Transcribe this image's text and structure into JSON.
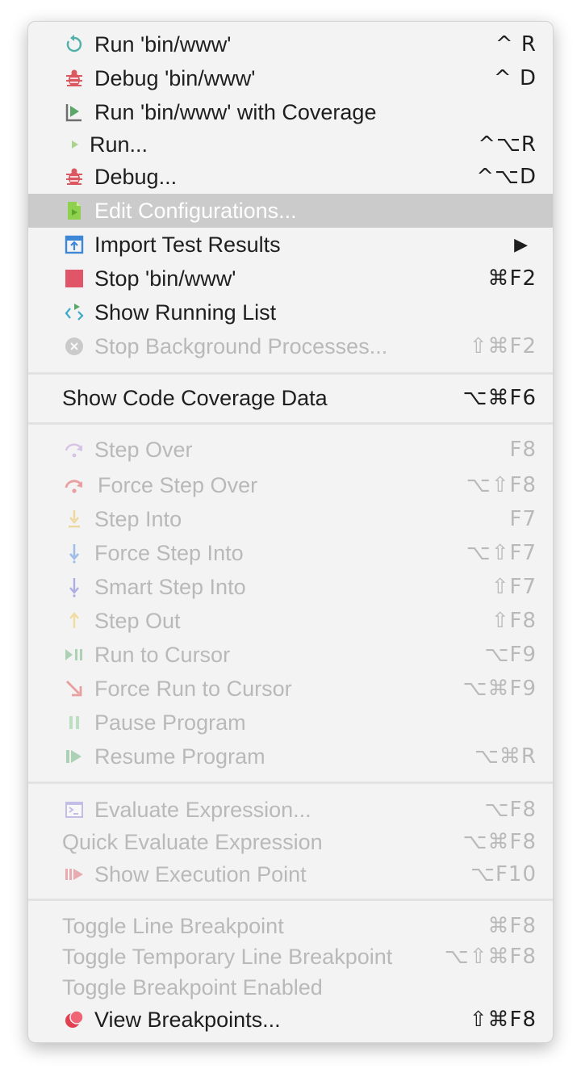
{
  "menu": {
    "items": [
      {
        "id": "run",
        "label": "Run 'bin/www'",
        "shortcut": "^ R",
        "icon": "rerun-icon"
      },
      {
        "id": "debug",
        "label": "Debug 'bin/www'",
        "shortcut": "^ D",
        "icon": "bug-icon"
      },
      {
        "id": "run-coverage",
        "label": "Run 'bin/www' with Coverage",
        "shortcut": "",
        "icon": "coverage-icon"
      },
      {
        "id": "run-dots",
        "label": "Run...",
        "shortcut": "^⌥R",
        "icon": "play-icon"
      },
      {
        "id": "debug-dots",
        "label": "Debug...",
        "shortcut": "^⌥D",
        "icon": "bug-icon"
      },
      {
        "id": "edit-configurations",
        "label": "Edit Configurations...",
        "shortcut": "",
        "icon": "edit-config-icon",
        "selected": true
      },
      {
        "id": "import-test-results",
        "label": "Import Test Results",
        "shortcut": "▶",
        "icon": "import-icon",
        "submenu": true
      },
      {
        "id": "stop",
        "label": "Stop 'bin/www'",
        "shortcut": "⌘F2",
        "icon": "stop-icon"
      },
      {
        "id": "show-running-list",
        "label": "Show Running List",
        "shortcut": "",
        "icon": "running-list-icon"
      },
      {
        "id": "stop-background",
        "label": "Stop Background Processes...",
        "shortcut": "⇧⌘F2",
        "icon": "cancel-icon",
        "disabled": true
      },
      {
        "id": "show-code-coverage",
        "label": "Show Code Coverage Data",
        "shortcut": "⌥⌘F6"
      },
      {
        "id": "step-over",
        "label": "Step Over",
        "shortcut": "F8",
        "icon": "step-over-icon",
        "disabled": true
      },
      {
        "id": "force-step-over",
        "label": "Force Step Over",
        "shortcut": "⌥⇧F8",
        "icon": "force-step-over-icon",
        "disabled": true
      },
      {
        "id": "step-into",
        "label": "Step Into",
        "shortcut": "F7",
        "icon": "step-into-icon",
        "disabled": true
      },
      {
        "id": "force-step-into",
        "label": "Force Step Into",
        "shortcut": "⌥⇧F7",
        "icon": "force-step-into-icon",
        "disabled": true
      },
      {
        "id": "smart-step-into",
        "label": "Smart Step Into",
        "shortcut": "⇧F7",
        "icon": "smart-step-into-icon",
        "disabled": true
      },
      {
        "id": "step-out",
        "label": "Step Out",
        "shortcut": "⇧F8",
        "icon": "step-out-icon",
        "disabled": true
      },
      {
        "id": "run-to-cursor",
        "label": "Run to Cursor",
        "shortcut": "⌥F9",
        "icon": "run-to-cursor-icon",
        "disabled": true
      },
      {
        "id": "force-run-to-cursor",
        "label": "Force Run to Cursor",
        "shortcut": "⌥⌘F9",
        "icon": "force-run-to-cursor-icon",
        "disabled": true
      },
      {
        "id": "pause-program",
        "label": "Pause Program",
        "shortcut": "",
        "icon": "pause-icon",
        "disabled": true
      },
      {
        "id": "resume-program",
        "label": "Resume Program",
        "shortcut": "⌥⌘R",
        "icon": "resume-icon",
        "disabled": true
      },
      {
        "id": "evaluate-expression",
        "label": "Evaluate Expression...",
        "shortcut": "⌥F8",
        "icon": "evaluate-icon",
        "disabled": true
      },
      {
        "id": "quick-evaluate",
        "label": "Quick Evaluate Expression",
        "shortcut": "⌥⌘F8",
        "disabled": true
      },
      {
        "id": "show-execution-point",
        "label": "Show Execution Point",
        "shortcut": "⌥F10",
        "icon": "execution-point-icon",
        "disabled": true
      },
      {
        "id": "toggle-line-breakpoint",
        "label": "Toggle Line Breakpoint",
        "shortcut": "⌘F8",
        "disabled": true
      },
      {
        "id": "toggle-temp-breakpoint",
        "label": "Toggle Temporary Line Breakpoint",
        "shortcut": "⌥⇧⌘F8",
        "disabled": true
      },
      {
        "id": "toggle-breakpoint-enabled",
        "label": "Toggle Breakpoint Enabled",
        "shortcut": "",
        "disabled": true
      },
      {
        "id": "view-breakpoints",
        "label": "View Breakpoints...",
        "shortcut": "⇧⌘F8",
        "icon": "breakpoints-icon"
      }
    ]
  },
  "colors": {
    "selection": "#cbcbcb",
    "menu_bg": "#f3f3f3",
    "text": "#1e1e1e",
    "disabled_text": "#b9b9b9",
    "run_green": "#59a869",
    "debug_red": "#db5860",
    "stop_red": "#e05568"
  }
}
